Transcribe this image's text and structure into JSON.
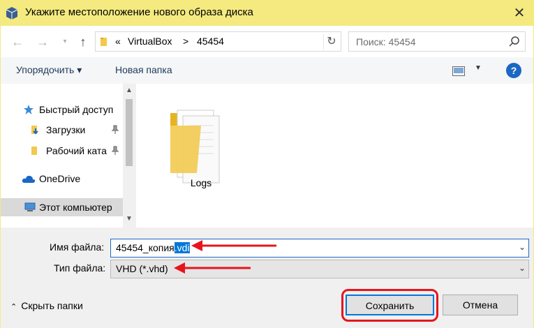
{
  "window": {
    "title": "Укажите местоположение нового образа диска"
  },
  "address": {
    "chevron": "«",
    "crumb1": "VirtualBox",
    "sep": ">",
    "crumb2": "45454"
  },
  "search": {
    "placeholder": "Поиск: 45454"
  },
  "toolbar": {
    "organize": "Упорядочить ▾",
    "new_folder": "Новая папка",
    "help": "?"
  },
  "nav": {
    "items": [
      {
        "label": "Быстрый доступ"
      },
      {
        "label": "Загрузки"
      },
      {
        "label": "Рабочий ката"
      },
      {
        "label": "OneDrive"
      },
      {
        "label": "Этот компьютер"
      }
    ]
  },
  "content": {
    "folders": [
      {
        "name": "Logs"
      }
    ]
  },
  "form": {
    "filename_label": "Имя файла:",
    "filename_base": "45454_копия",
    "filename_ext": ".vdi",
    "filetype_label": "Тип файла:",
    "filetype_value": "VHD (*.vhd)"
  },
  "footer": {
    "hide_folders": "Скрыть папки",
    "save": "Сохранить",
    "cancel": "Отмена"
  },
  "colors": {
    "titlebar": "#f4ea7f",
    "accent": "#0078d7",
    "annotation_red": "#e8141c"
  }
}
